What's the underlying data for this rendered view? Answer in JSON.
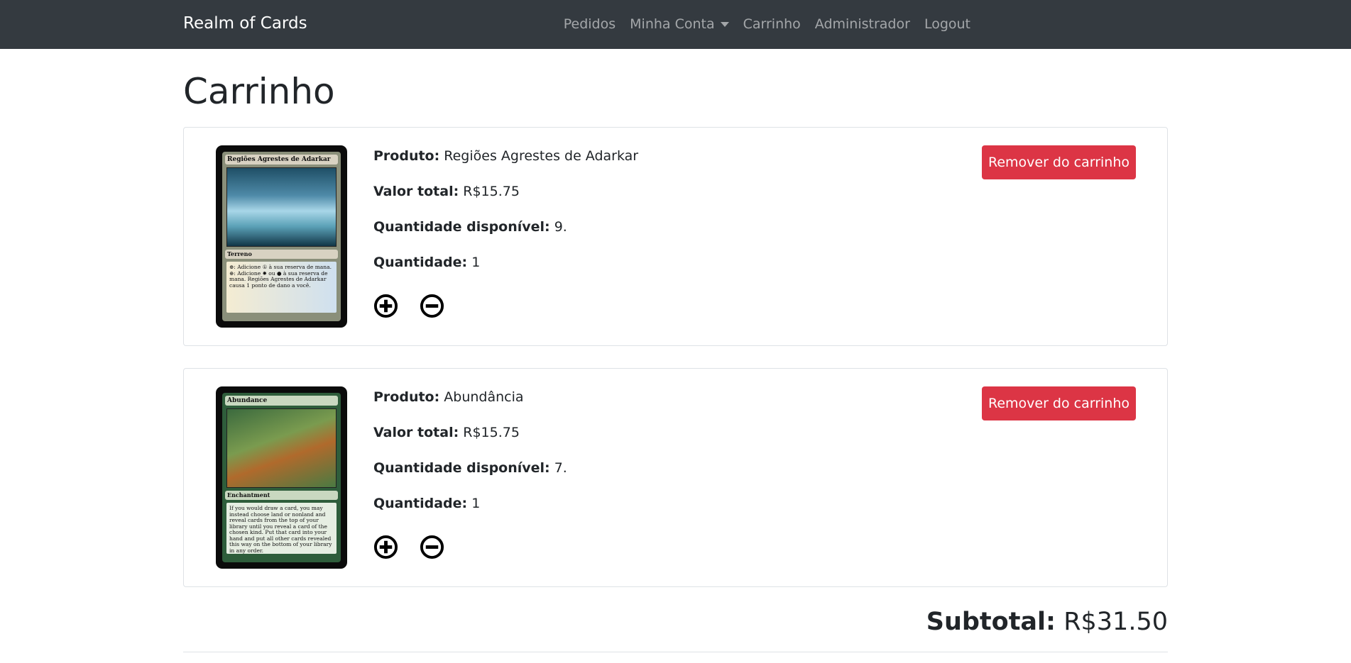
{
  "navbar": {
    "brand": "Realm of Cards",
    "links": [
      "Pedidos",
      "Minha Conta",
      "Carrinho",
      "Administrador",
      "Logout"
    ]
  },
  "page": {
    "title": "Carrinho"
  },
  "labels": {
    "product": "Produto:",
    "total_value": "Valor total:",
    "available": "Quantidade disponível:",
    "quantity": "Quantidade:",
    "remove": "Remover do carrinho",
    "subtotal": "Subtotal:"
  },
  "items": [
    {
      "product": "Regiões Agrestes de Adarkar",
      "total_value": "R$15.75",
      "available": "9.",
      "quantity": "1",
      "card_image": {
        "title": "Regiões Agrestes de Adarkar",
        "type": "Terreno",
        "text": "⊕: Adicione ① à sua reserva de mana. ⊕: Adicione ✹ ou ● à sua reserva de mana. Regiões Agrestes de Adarkar causa 1 ponto de dano a você."
      }
    },
    {
      "product": "Abundância",
      "total_value": "R$15.75",
      "available": "7.",
      "quantity": "1",
      "card_image": {
        "title": "Abundance",
        "type": "Enchantment",
        "text": "If you would draw a card, you may instead choose land or nonland and reveal cards from the top of your library until you reveal a card of the chosen kind. Put that card into your hand and put all other cards revealed this way on the bottom of your library in any order."
      }
    }
  ],
  "summary": {
    "subtotal": "R$31.50"
  },
  "colors": {
    "navbar": "#343a40",
    "danger": "#dc3545",
    "text": "#212529"
  },
  "icons": {
    "increase": "plus-circle-icon",
    "decrease": "minus-circle-icon"
  }
}
